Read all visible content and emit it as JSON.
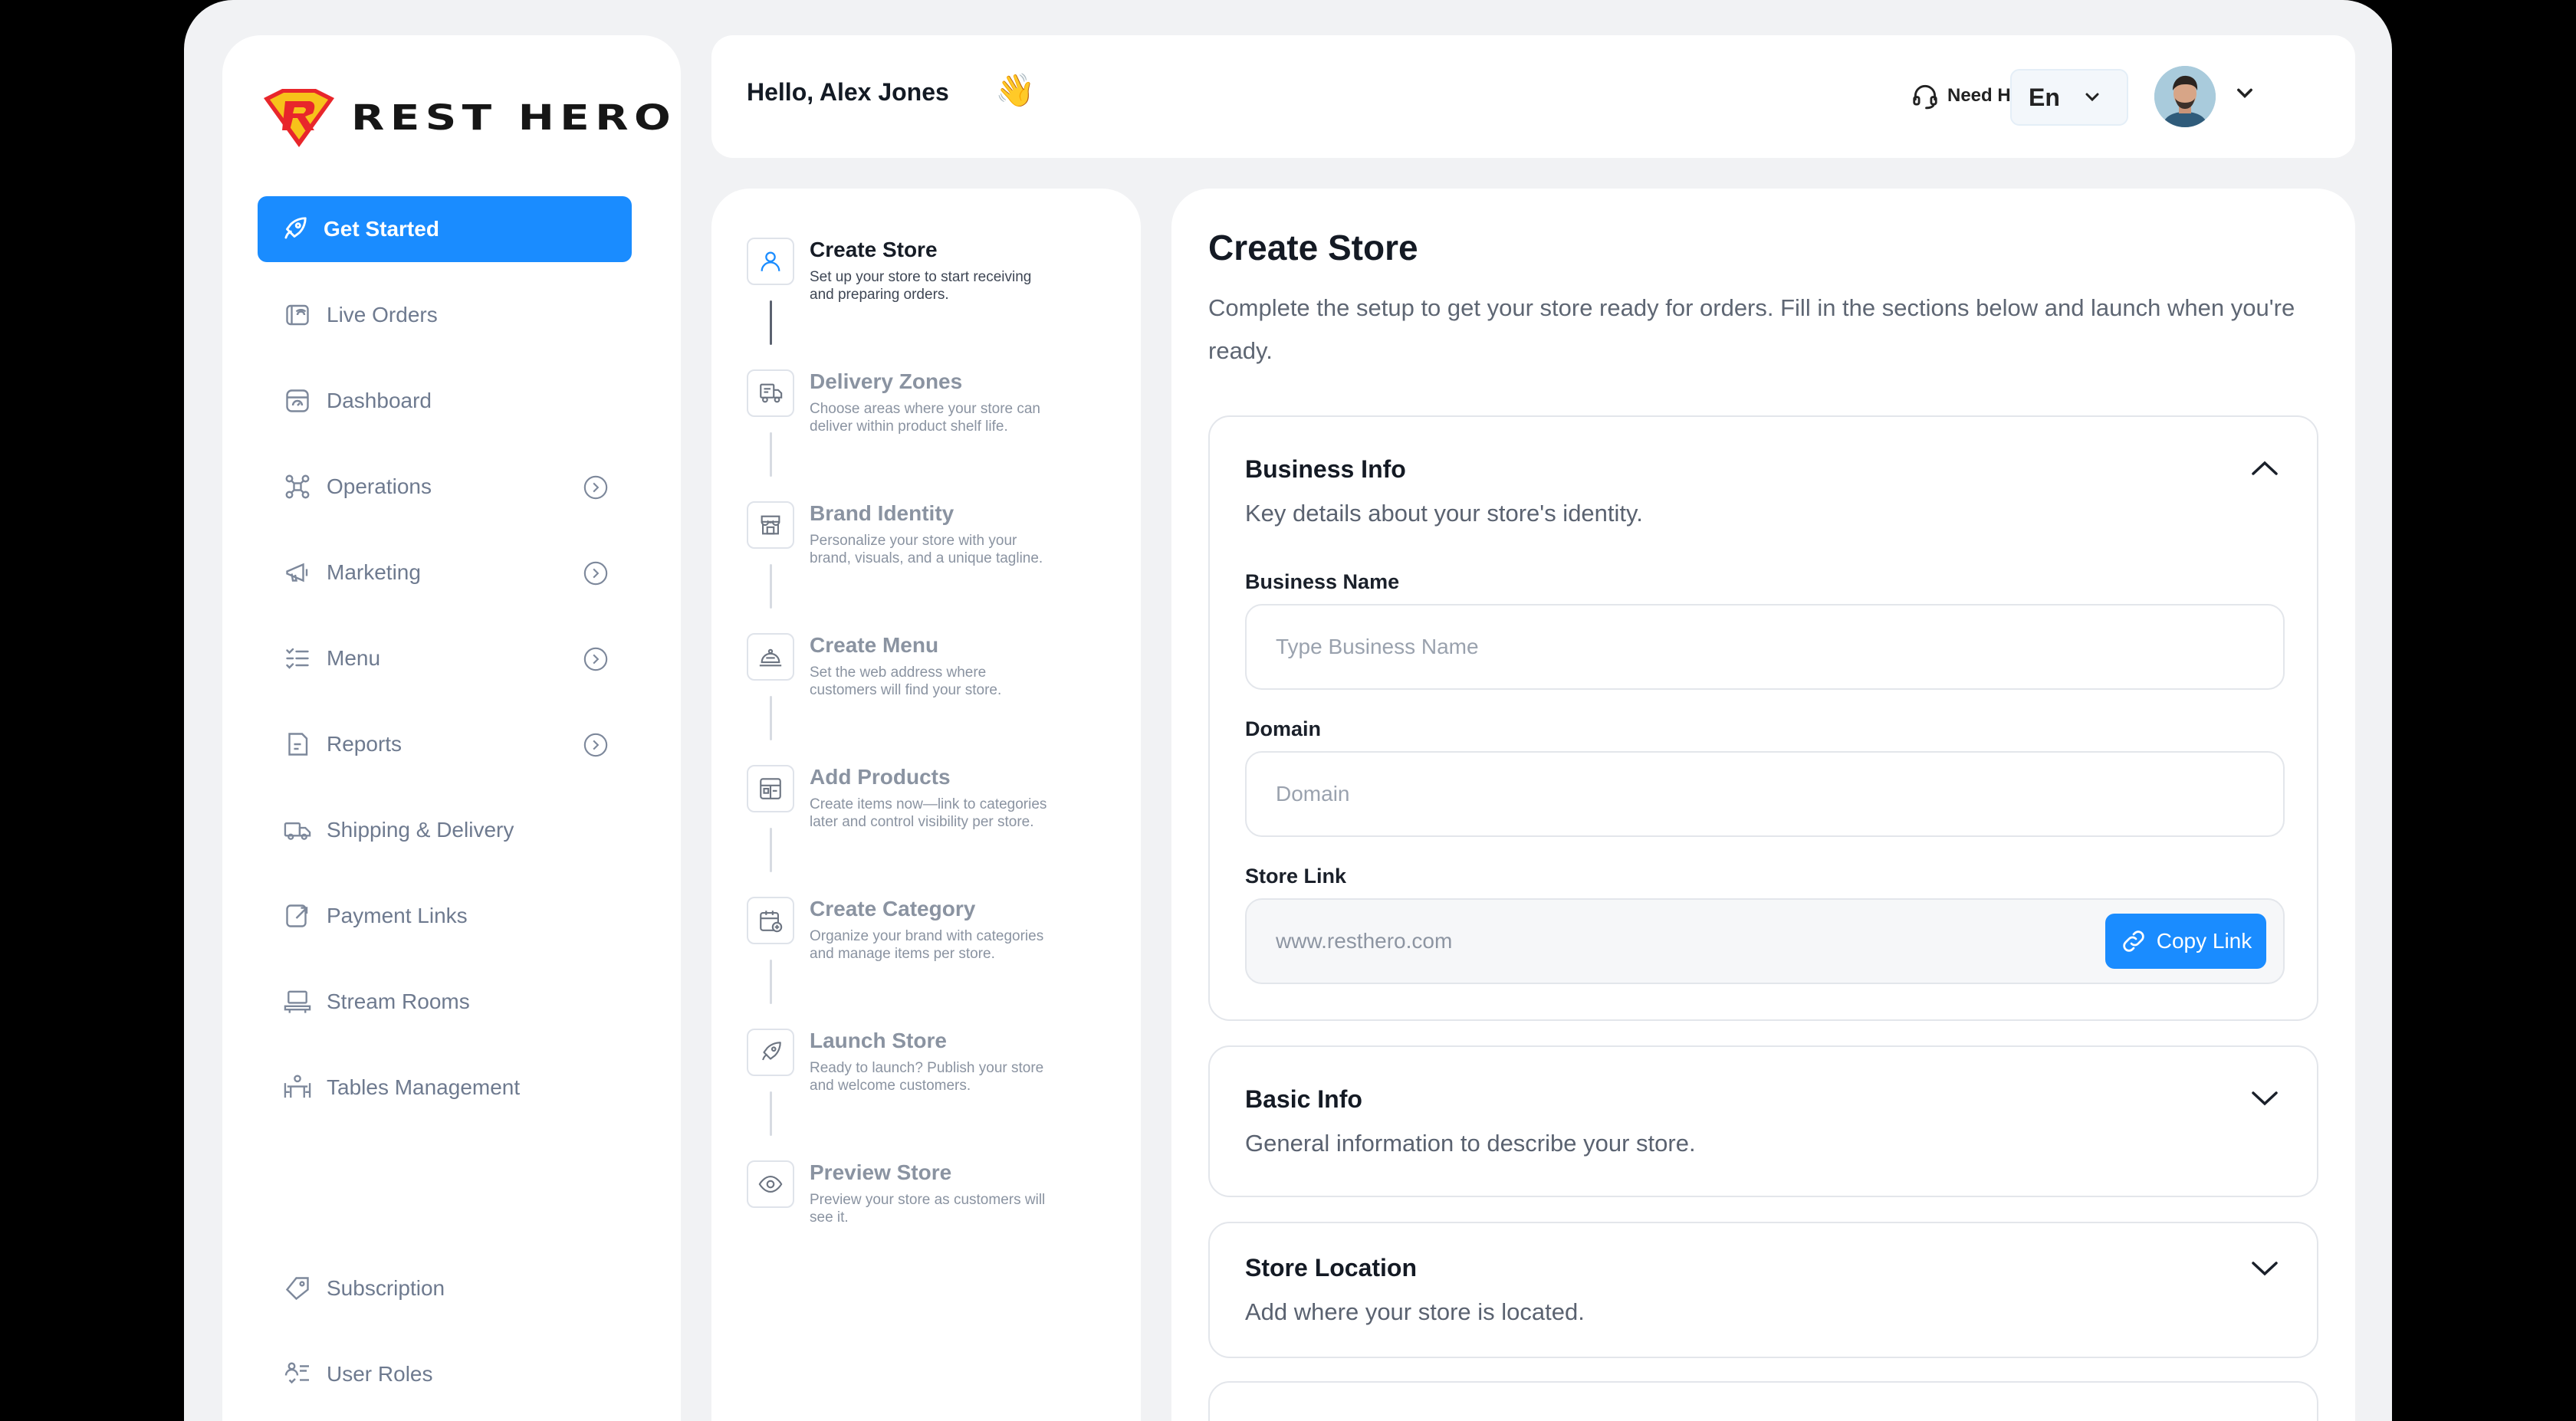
{
  "brand": {
    "name": "REST HERO"
  },
  "sidebar": {
    "items": [
      {
        "label": "Get Started",
        "active": true,
        "icon": "rocket-icon"
      },
      {
        "label": "Live Orders",
        "icon": "live-orders-icon"
      },
      {
        "label": "Dashboard",
        "icon": "dashboard-icon"
      },
      {
        "label": "Operations",
        "icon": "operations-icon",
        "expandable": true
      },
      {
        "label": "Marketing",
        "icon": "megaphone-icon",
        "expandable": true
      },
      {
        "label": "Menu",
        "icon": "menu-list-icon",
        "expandable": true
      },
      {
        "label": "Reports",
        "icon": "reports-icon",
        "expandable": true
      },
      {
        "label": "Shipping & Delivery",
        "icon": "truck-icon"
      },
      {
        "label": "Payment Links",
        "icon": "payment-link-icon"
      },
      {
        "label": "Stream Rooms",
        "icon": "stream-icon"
      },
      {
        "label": "Tables Management",
        "icon": "tables-icon"
      }
    ],
    "bottom_items": [
      {
        "label": "Subscription",
        "icon": "tag-icon"
      },
      {
        "label": "User Roles",
        "icon": "user-roles-icon"
      }
    ]
  },
  "header": {
    "greeting": "Hello, Alex Jones",
    "wave": "👋",
    "help_label": "Need Help?",
    "language": "En"
  },
  "steps": [
    {
      "title": "Create Store",
      "desc": "Set up your store to start receiving and preparing orders.",
      "icon": "user-icon",
      "current": true
    },
    {
      "title": "Delivery Zones",
      "desc": "Choose areas where your store can deliver within product shelf life.",
      "icon": "delivery-icon"
    },
    {
      "title": "Brand Identity",
      "desc": "Personalize your store with your brand, visuals, and a unique tagline.",
      "icon": "storefront-icon"
    },
    {
      "title": "Create Menu",
      "desc": "Set the web address where customers will find your store.",
      "icon": "cloche-icon"
    },
    {
      "title": "Add Products",
      "desc": "Create items now—link to categories later and control visibility per store.",
      "icon": "products-icon"
    },
    {
      "title": "Create Category",
      "desc": "Organize your brand with categories and manage items per store.",
      "icon": "category-icon"
    },
    {
      "title": "Launch Store",
      "desc": "Ready to launch? Publish your store and welcome customers.",
      "icon": "rocket-icon"
    },
    {
      "title": "Preview Store",
      "desc": "Preview your store as customers will see it.",
      "icon": "eye-icon"
    }
  ],
  "main": {
    "title": "Create Store",
    "subtitle": "Complete the setup to get your store ready for orders. Fill in the sections below and launch when you're ready.",
    "business_info": {
      "title": "Business Info",
      "subtitle": "Key details about your store's identity.",
      "business_name_label": "Business Name",
      "business_name_placeholder": "Type Business Name",
      "domain_label": "Domain",
      "domain_placeholder": "Domain",
      "store_link_label": "Store Link",
      "store_link_value": "www.resthero.com",
      "copy_label": "Copy Link"
    },
    "basic_info": {
      "title": "Basic Info",
      "subtitle": "General information to describe your store."
    },
    "store_location": {
      "title": "Store Location",
      "subtitle": "Add where your store is located."
    }
  },
  "colors": {
    "accent": "#1a8cff",
    "background": "#f1f2f4",
    "logo_red": "#e8262b",
    "logo_yellow": "#f7c21a"
  }
}
